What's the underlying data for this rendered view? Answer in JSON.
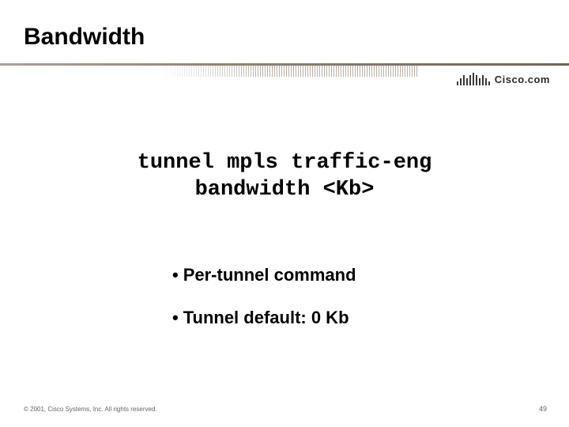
{
  "title": "Bandwidth",
  "command": {
    "line1": "tunnel mpls traffic-eng",
    "line2": "bandwidth <Kb>"
  },
  "bullets": [
    "Per-tunnel command",
    "Tunnel default: 0 Kb"
  ],
  "branding": {
    "logo_text": "Cisco.com"
  },
  "footer": {
    "copyright": "© 2001, Cisco Systems, Inc. All rights reserved.",
    "page_number": "49"
  }
}
